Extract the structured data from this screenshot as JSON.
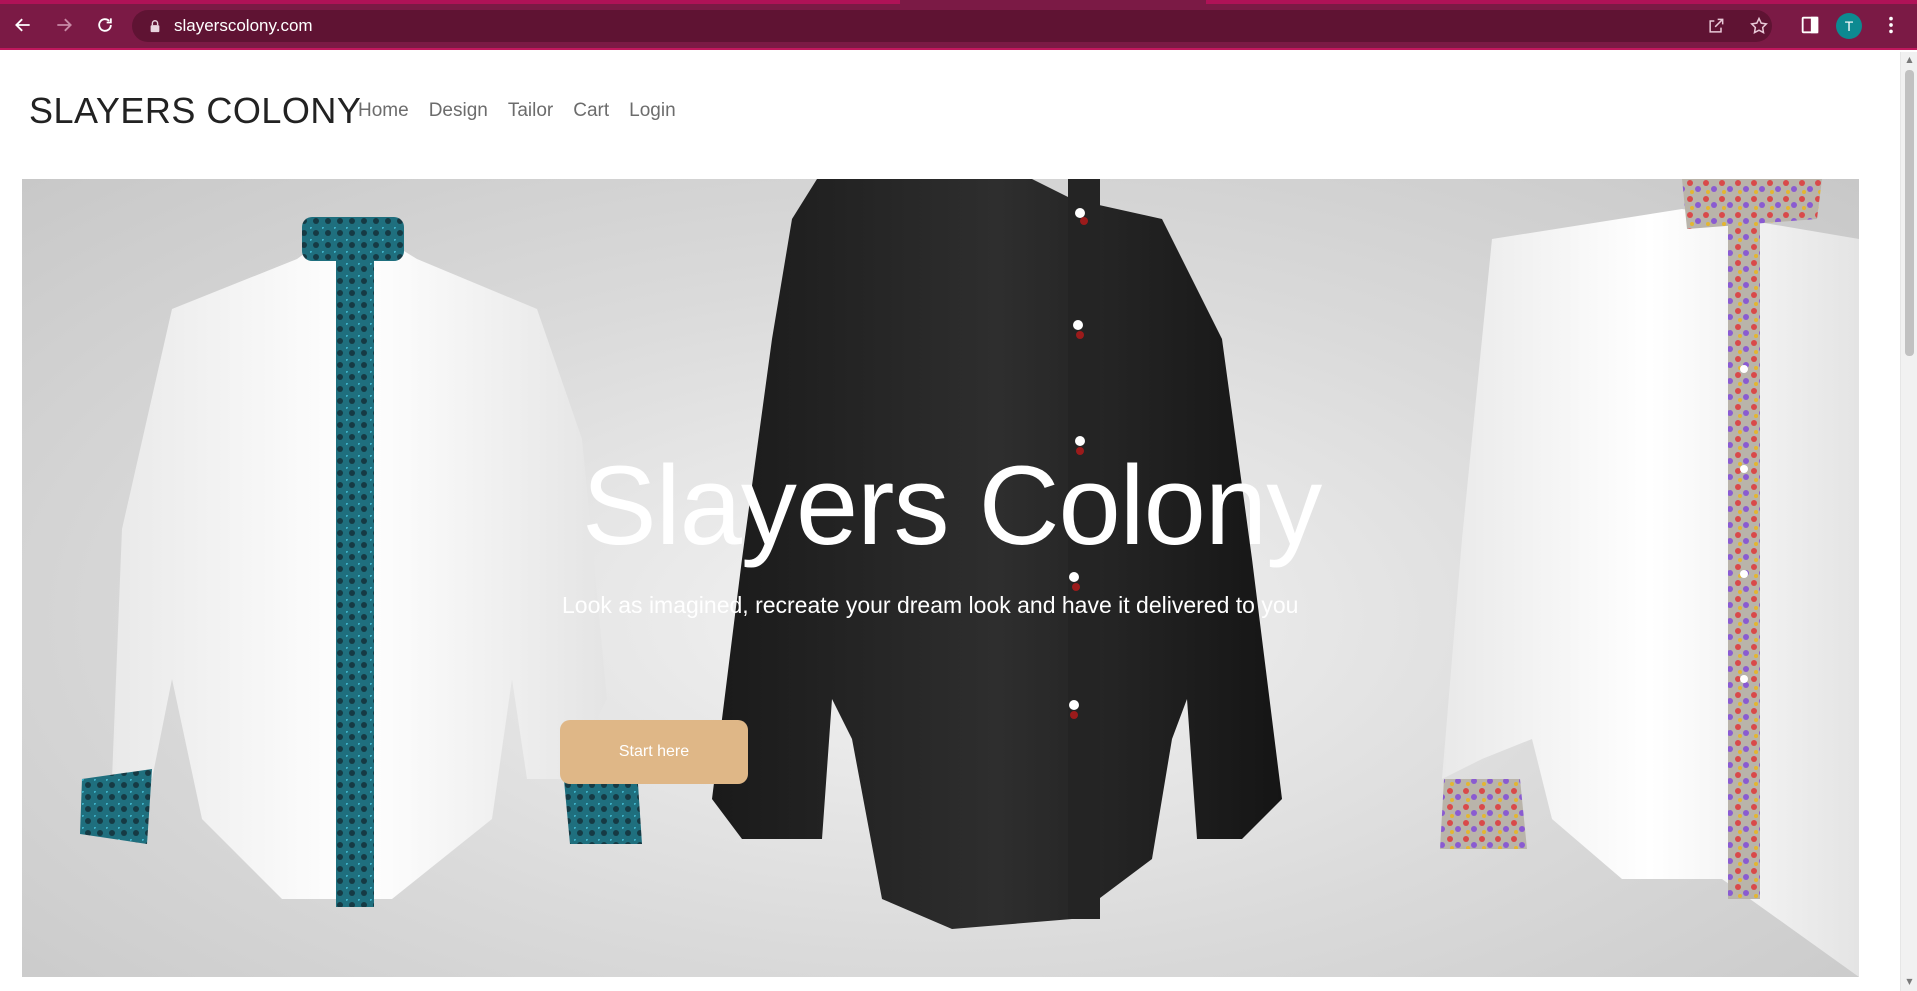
{
  "browser": {
    "url": "slayerscolony.com",
    "profile_initial": "T",
    "icons": {
      "back": "back-arrow-icon",
      "forward": "forward-arrow-icon",
      "reload": "reload-icon",
      "lock": "lock-icon",
      "share": "share-icon",
      "bookmark": "star-icon",
      "sidepanel": "side-panel-icon",
      "menu": "kebab-menu-icon"
    },
    "colors": {
      "frame": "#7b1a45",
      "omnibox": "#5f1333",
      "avatar": "#0d8a91"
    }
  },
  "site": {
    "brand": "SLAYERS COLONY",
    "nav": [
      {
        "label": "Home"
      },
      {
        "label": "Design"
      },
      {
        "label": "Tailor"
      },
      {
        "label": "Cart"
      },
      {
        "label": "Login"
      }
    ],
    "hero": {
      "title": "Slayers Colony",
      "subtitle": "Look as imagined, recreate your dream look and have it delivered to you",
      "cta": "Start here",
      "cta_color": "#dfb787"
    }
  }
}
